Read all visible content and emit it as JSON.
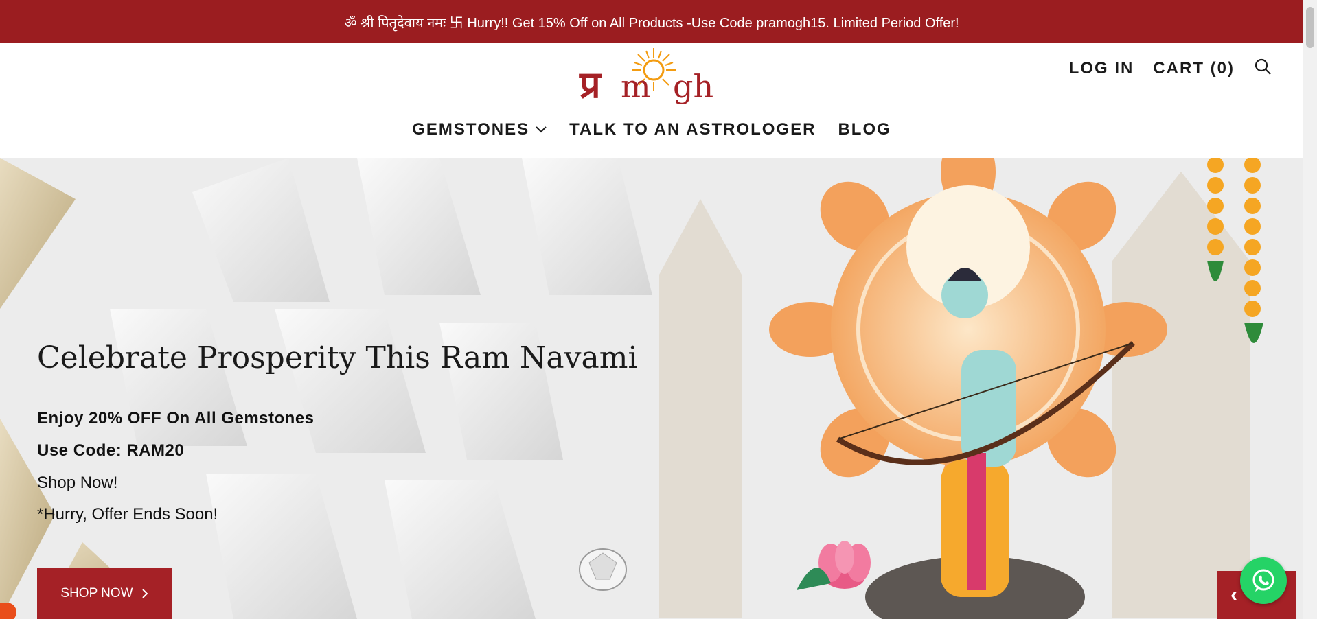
{
  "announcement": {
    "text": "ॐ श्री पितृदेवाय नमः 卐 Hurry!! Get 15% Off on All Products -Use Code pramogh15. Limited Period Offer!"
  },
  "header": {
    "logo_text": "Pramogh",
    "login": "LOG IN",
    "cart": "CART (0)",
    "nav": [
      {
        "label": "GEMSTONES"
      },
      {
        "label": "TALK TO AN ASTROLOGER"
      },
      {
        "label": "BLOG"
      }
    ]
  },
  "hero": {
    "title": "Celebrate Prosperity This Ram Navami",
    "offer": "Enjoy 20% OFF On All Gemstones",
    "code": "Use Code: RAM20",
    "cta_text": "Shop Now!",
    "note": "*Hurry, Offer Ends Soon!",
    "button": "SHOP NOW",
    "prev": "‹",
    "next": "›"
  },
  "colors": {
    "brand": "#9b1d20",
    "accent": "#a52126",
    "whatsapp": "#25d366"
  },
  "icons": [
    "search-icon",
    "chevron-down-icon",
    "chevron-right-icon",
    "whatsapp-icon"
  ]
}
